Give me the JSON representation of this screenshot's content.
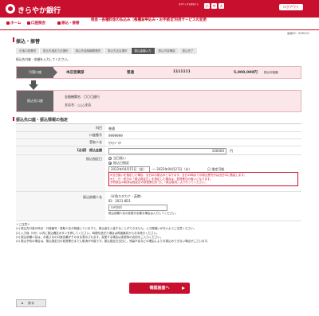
{
  "header": {
    "bank_name": "きらやか銀行",
    "font_size_label": "文字サイズを変更する",
    "font_small": "小",
    "font_medium": "中",
    "font_large": "大",
    "logout": "ログアウト"
  },
  "nav": {
    "home": "ホーム",
    "balance": "口座照会",
    "transfer": "振込・振替",
    "tax": "税金・各種料金の払込み（ペイジー）",
    "time_deposit": "各種お申込み・お手続き",
    "settings": "ご利用サービスの変更"
  },
  "screen_id": "画面ID：BKR002",
  "page_title": "振込・振替",
  "steps": [
    "引落口座選択",
    "振込先指定方法選択",
    "振込先金融機関選択",
    "振込先支店選択",
    "振込金額入力",
    "振込内容確認",
    "振込完了"
  ],
  "info_text": "振込先口座・金額を入力してください。",
  "debit": {
    "tag": "引落口座",
    "branch": "本店営業部",
    "type": "普通",
    "number": "1111111",
    "balance": "5,000,000円",
    "balance_label": "振込可能額"
  },
  "dest": {
    "tag": "振込先口座",
    "bank_line": "金融機関名：〇〇〇銀行",
    "branch_line": "支店名：△△△支店"
  },
  "section_title": "振込先口座・振込情報の指定",
  "form": {
    "subject_label": "科目",
    "subject_value": "普通",
    "account_label": "口座番号",
    "account_value": "9999999",
    "payee_label": "受取人名",
    "payee_value": "ｶﾜﾓﾄｼﾞﾛｳ",
    "amount_label": "【必須】 振込金額",
    "amount_value": "100000",
    "amount_unit": "円",
    "date_label": "振込指定日",
    "date_option1": "当日扱い",
    "date_option2": "振込日指定",
    "date_select": "2022年04月15日（金）",
    "date_tilde": "～ 2022年04月27日（水）",
    "date_calendar": "日 指定可能",
    "note1": "※当日扱いを指定した場合、当日のお振込みとなります。当日15時までの振込受付分は当日中に着金します。",
    "note2": "※土・日・祝日の「振込指定日」を指定した場合は、翌営業日の扱いとなります。",
    "note3": "予約振込の取消は指定日の前営業日までに「振込取消」より行ってください。",
    "requester_label": "振込依頼人名",
    "requester_hint": "（半角カタカナ・英数）",
    "requester_id": "ID：2021 8D1",
    "requester_value": "ｷﾗﾔｶﾀﾛｳ",
    "requester_note": "振込依頼人名の変更が必要な場合は入力してください。"
  },
  "notes": {
    "title": "＜ご注意＞",
    "n1": "(1) 振込先口座の科目・口座番号・受取人名が相違していますと、振込金を入金することができません。入力間違いがないようご注意ください。",
    "n2": "(2) 入力後（5分）以内に振込確定ボタンを押してください。時間を過ぎた場合は再度最初からお手続きください。",
    "n3": "(3) 振込依頼人名は、お客さまの口座名義がそのまま表示されます。変更する場合は変更後の名前をご入力ください。",
    "n4": "(4) 振込予約の場合は、振込指定日の前営業日までに取消が可能です。振込指定日当日に、残高不足などの理由によりお振込みできない場合がございます。"
  },
  "buttons": {
    "confirm": "確認画面へ",
    "back": "戻る"
  },
  "colors": {
    "brand": "#c8102e"
  }
}
